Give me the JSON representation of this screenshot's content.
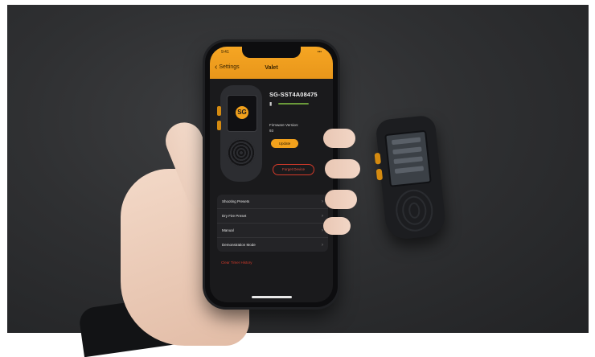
{
  "status_bar": {
    "time": "9:41",
    "indicators": "•••"
  },
  "nav": {
    "back_label": "Settings",
    "title": "Valet"
  },
  "device": {
    "serial": "SG-SST4A08475",
    "firmware_label": "Firmware Version:",
    "firmware_value": "93",
    "update_label": "Update",
    "forget_label": "Forget Device",
    "logo_text": "SG"
  },
  "menu": {
    "items": [
      {
        "label": "Shooting Presets"
      },
      {
        "label": "Dry Fire Preset"
      },
      {
        "label": "Manual"
      },
      {
        "label": "Demonstration Mode"
      }
    ]
  },
  "clear_label": "Clear Timer History",
  "colors": {
    "accent": "#f2a11c",
    "danger": "#d23a2a",
    "background": "#1a1a1c"
  },
  "icons": {
    "back": "chevron-left-icon",
    "row_arrow": "chevron-right-icon",
    "battery": "battery-icon"
  }
}
